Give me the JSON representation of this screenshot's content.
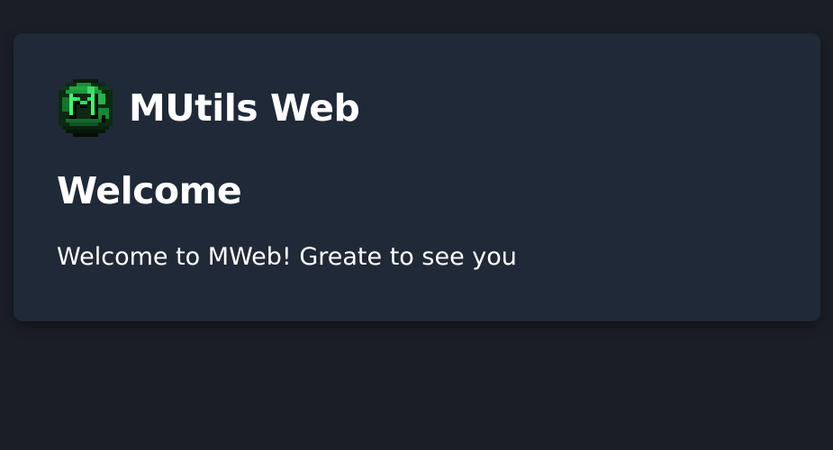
{
  "header": {
    "logo_icon": "mutils-pixel-logo-icon",
    "title": "MUtils Web"
  },
  "main": {
    "heading": "Welcome",
    "message": "Welcome to MWeb! Greate to see you"
  },
  "colors": {
    "background": "#1b1e27",
    "card": "#1f2937",
    "text": "#ffffff",
    "logo_green": "#22c55e"
  }
}
